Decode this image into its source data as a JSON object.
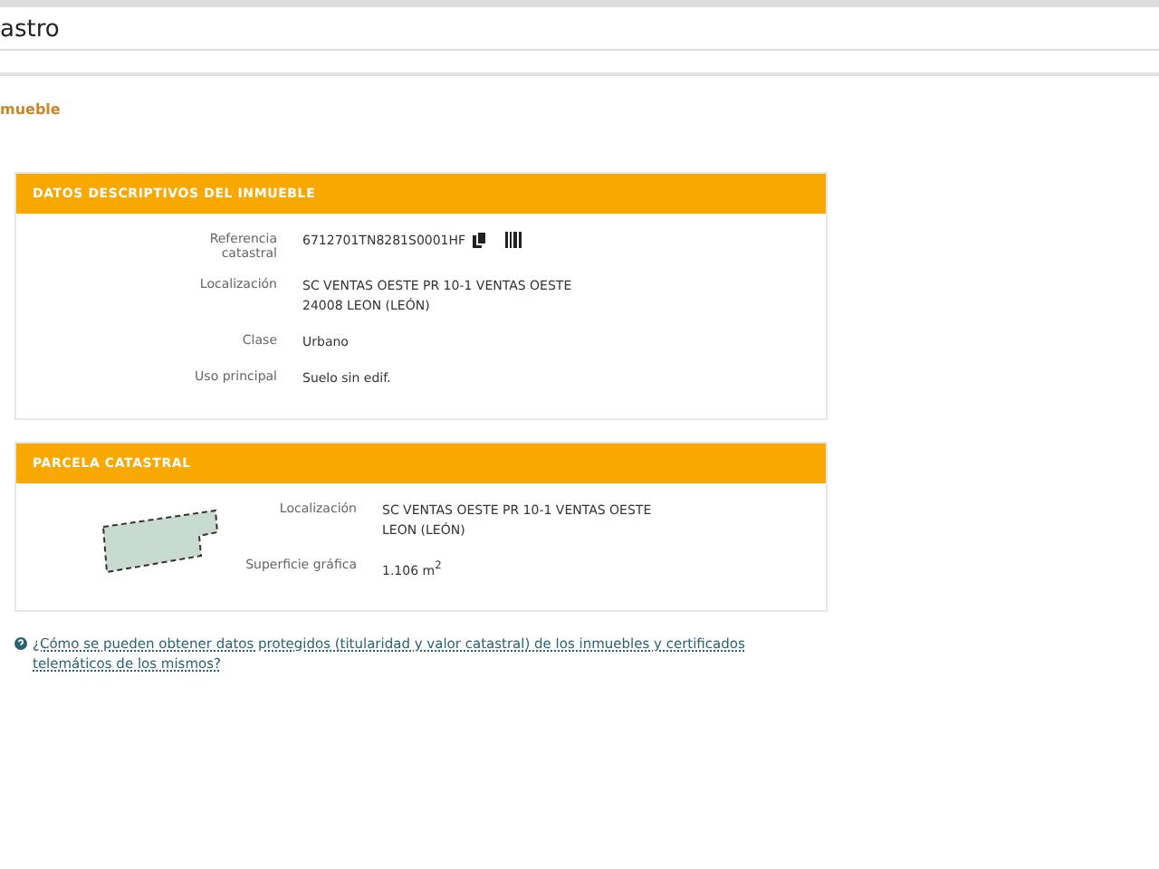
{
  "header": {
    "title": "astro"
  },
  "section_title": "mueble",
  "panels": [
    {
      "kind": "details",
      "title": "DATOS DESCRIPTIVOS DEL INMUEBLE",
      "rows": [
        {
          "label": "Referencia catastral",
          "value": [
            "6712701TN8281S0001HF"
          ],
          "kind": "reference"
        },
        {
          "label": "Localización",
          "value": [
            "SC VENTAS OESTE PR 10-1 VENTAS OESTE",
            "24008 LEON (LEÓN)"
          ],
          "kind": "text"
        },
        {
          "label": "Clase",
          "value": [
            "Urbano"
          ],
          "kind": "text"
        },
        {
          "label": "Uso principal",
          "value": [
            "Suelo sin edif."
          ],
          "kind": "text"
        }
      ]
    },
    {
      "kind": "parcel",
      "title": "PARCELA CATASTRAL",
      "rows": [
        {
          "label": "Localización",
          "value": [
            "SC VENTAS OESTE PR 10-1 VENTAS OESTE",
            "LEON (LEÓN)"
          ],
          "kind": "text"
        },
        {
          "label": "Superficie gráfica",
          "value": [
            "1.106 m$^{2}$"
          ],
          "kind": "text"
        }
      ]
    }
  ],
  "help_link": "¿Cómo se pueden obtener datos protegidos (titularidad y valor catastral) de los inmuebles y certificados telemáticos de los mismos?"
}
